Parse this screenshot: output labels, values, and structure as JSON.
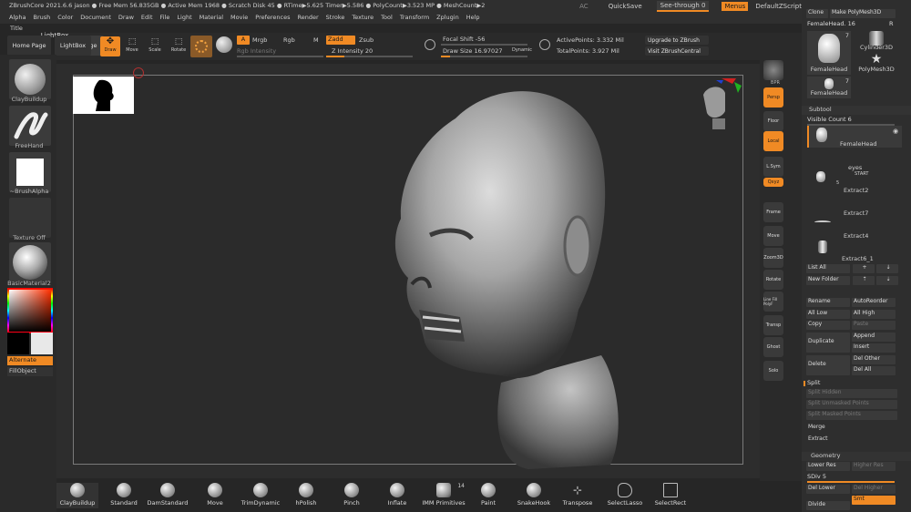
{
  "statusbar": {
    "text": "ZBrushCore 2021.6.6   jason   ● Free Mem 56.835GB ● Active Mem 1968 ● Scratch Disk 45 ● RTime▶5.625 Timer▶5.586 ● PolyCount▶3.523 MP ● MeshCount▶2",
    "ac": "AC",
    "quicksave": "QuickSave",
    "seethrough": "See-through  0",
    "menus": "Menus",
    "defaultzscript": "DefaultZScript"
  },
  "menu": [
    "Alpha",
    "Brush",
    "Color",
    "Document",
    "Draw",
    "Edit",
    "File",
    "Light",
    "Material",
    "Movie",
    "Preferences",
    "Render",
    "Stroke",
    "Texture",
    "Tool",
    "Transform",
    "Zplugin",
    "Help"
  ],
  "title_label": "Title",
  "shelf": {
    "home_page": "Home Page",
    "lightbox": "LightBox",
    "draw": "Draw",
    "move": "Move",
    "scale": "Scale",
    "rotate": "Rotate",
    "a": "A",
    "mrgb": "Mrgb",
    "rgb": "Rgb",
    "m": "M",
    "zadd": "Zadd",
    "zsub": "Zsub",
    "rgb_intensity": "Rgb Intensity",
    "z_intensity": "Z Intensity 20",
    "focal_shift": "Focal Shift -56",
    "draw_size": "Draw Size 16.97027",
    "dynamic": "Dynamic",
    "active_points": "ActivePoints: 3.332 Mil",
    "total_points": "TotalPoints: 3.927 Mil",
    "upgrade": "Upgrade to ZBrush",
    "visit": "Visit ZBrushCentral"
  },
  "left": {
    "brush1": "ClayBuildup",
    "brush2": "FreeHand",
    "brush3": "~BrushAlpha",
    "texture": "Texture Off",
    "material": "BasicMaterial2",
    "alternate": "Alternate",
    "fillobject": "FillObject"
  },
  "rightshelf": [
    "BPR",
    "Persp",
    "Floor",
    "Local",
    "L.Sym",
    "Qxyz",
    "Frame",
    "Move",
    "Zoom3D",
    "Rotate",
    "Line Fill PolyF",
    "Transp",
    "Ghost",
    "Solo"
  ],
  "tray": {
    "clone": "Clone",
    "make_polymesh": "Make PolyMesh3D",
    "tool_name": "FemaleHead. 16",
    "r": "R",
    "thumb_femalehead": "FemaleHead",
    "thumb_femalehead_count": "7",
    "thumb_cylinder": "Cylinder3D",
    "thumb_polymesh": "PolyMesh3D",
    "thumb_femalehead2": "FemaleHead",
    "thumb_femalehead2_count": "7",
    "subtool": "Subtool",
    "visible_count": "Visible Count 6",
    "subtools": [
      "FemaleHead",
      "eyes",
      "Extract2",
      "Extract7",
      "Extract4",
      "Extract6_1"
    ],
    "list_all": "List All",
    "new_folder": "New Folder",
    "rename": "Rename",
    "autoreorder": "AutoReorder",
    "all_low": "All Low",
    "all_high": "All High",
    "copy": "Copy",
    "paste": "Paste",
    "duplicate": "Duplicate",
    "append": "Append",
    "insert": "Insert",
    "delete": "Delete",
    "del_other": "Del Other",
    "del_all": "Del All",
    "split": "Split",
    "split_hidden": "Split Hidden",
    "split_unmasked": "Split Unmasked Points",
    "split_masked": "Split Masked Points",
    "merge": "Merge",
    "extract": "Extract",
    "geometry": "Geometry",
    "lower_res": "Lower Res",
    "higher_res": "Higher Res",
    "sdiv": "SDiv 5",
    "del_lower": "Del Lower",
    "del_higher": "Del Higher",
    "smt": "Smt",
    "divide": "Divide",
    "start": "START",
    "five": "5"
  },
  "bottom": [
    "ClayBuildup",
    "Standard",
    "DamStandard",
    "Move",
    "TrimDynamic",
    "hPolish",
    "Pinch",
    "Inflate",
    "IMM Primitives",
    "Paint",
    "SnakeHook",
    "Transpose",
    "SelectLasso",
    "SelectRect"
  ],
  "imm_count": "14"
}
